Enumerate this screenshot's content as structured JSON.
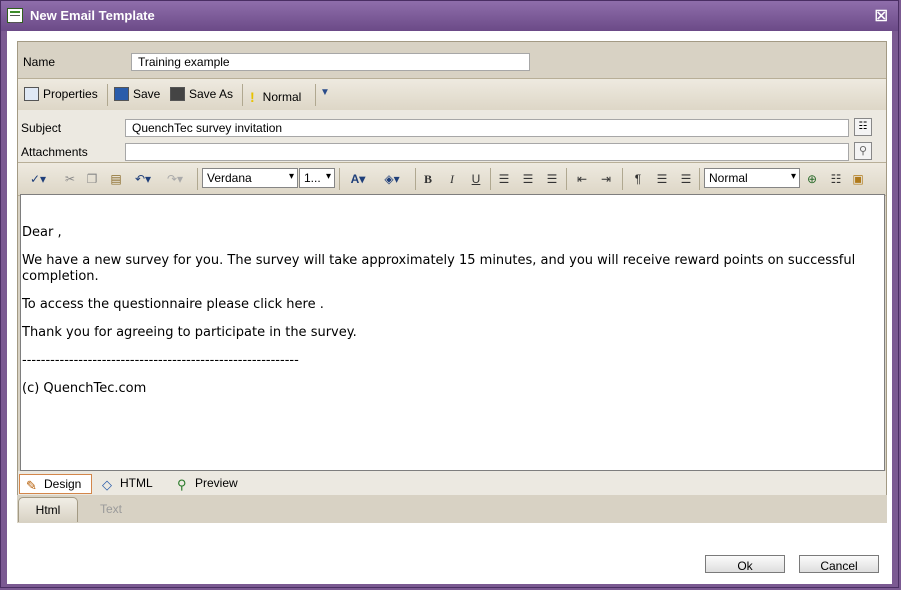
{
  "window": {
    "title": "New Email Template",
    "close_glyph": "☒"
  },
  "form": {
    "name_label": "Name",
    "name_value": "Training example",
    "subject_label": "Subject",
    "subject_value": "QuenchTec survey invitation",
    "attachments_label": "Attachments",
    "attachments_value": ""
  },
  "toolbar": {
    "properties_label": "Properties",
    "save_label": "Save",
    "save_as_label": "Save As",
    "priority_label": "Normal"
  },
  "editor_toolbar": {
    "font_name": "Verdana",
    "font_size": "1...",
    "paragraph_style": "Normal"
  },
  "body": {
    "greeting": "Dear ,",
    "para1": "We have a new survey for you.  The survey will take approximately 15 minutes, and you will receive  reward points on successful completion.",
    "para2": "To access the questionnaire please click here .",
    "para3": "Thank you for agreeing to participate in the survey.",
    "divider": "-----------------------------------------------------------",
    "footer": "(c) QuenchTec.com"
  },
  "modes": [
    "Design",
    "HTML",
    "Preview"
  ],
  "tabs": [
    "Html",
    "Text"
  ],
  "buttons": {
    "ok": "Ok",
    "cancel": "Cancel"
  }
}
